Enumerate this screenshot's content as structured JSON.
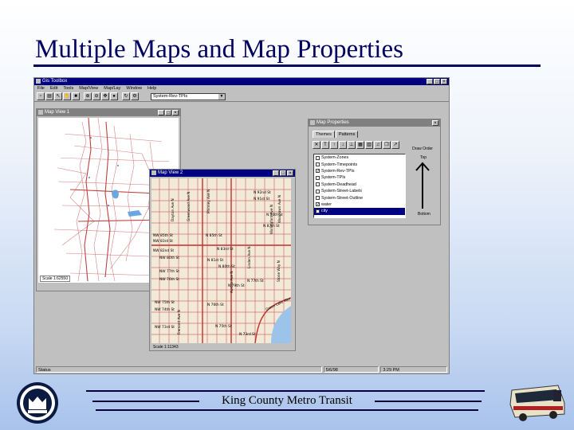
{
  "slide": {
    "title": "Multiple Maps and Map Properties",
    "footer": "King County Metro Transit"
  },
  "app": {
    "title": "Gis Toolbox",
    "menu": [
      "File",
      "Edit",
      "Tools",
      "Map/View",
      "Map/Lay",
      "Window",
      "Help"
    ],
    "toolbar_icons": [
      "new-icon",
      "open-icon",
      "arrow-icon",
      "hand-icon",
      "save-icon",
      "zoom-in-icon",
      "zoom-out-icon",
      "pan-icon",
      "globe-icon",
      "refresh-icon",
      "gear-icon"
    ],
    "layer_combo": "System-Rev-TPIs",
    "status": {
      "left": "Status",
      "date": "5/6/98",
      "time": "3:29 PM"
    }
  },
  "map_view_1": {
    "title": "Map View 1",
    "scale": "Scale 1:62550"
  },
  "map_view_2": {
    "title": "Map View 2",
    "scale": "Scale 1:11343",
    "labels": [
      "NW 85th St",
      "NW 83rd St",
      "NW 82nd St",
      "NW 80th St",
      "NW 77th St",
      "NW 76th St",
      "NW 75th St",
      "NW 74th St",
      "NW 73rd St",
      "N 85th St",
      "N 83rd St",
      "N 81st St",
      "N 80th St",
      "N 79th St",
      "N 77th St",
      "N 76th St",
      "N 75th St",
      "N 73rd St",
      "Phinney Ave N",
      "Fremont Ave N",
      "Dayton Ave N",
      "Greenwood Ave N",
      "Aurora Ave N",
      "Linden Ave N",
      "Stone Way N",
      "Wallingford Ave N",
      "Green Lake Way N",
      "Woodlawn Ave N",
      "N 92nd St",
      "N 91st St",
      "N 90th St",
      "N 87th St"
    ]
  },
  "map_properties": {
    "title": "Map Properties",
    "tabs": [
      "Themes",
      "Patterns"
    ],
    "tool_icons": [
      "close-x-icon",
      "text-t-icon",
      "up-icon",
      "down-icon",
      "bottom-icon",
      "grid-icon",
      "table-icon",
      "music-icon",
      "copy-icon",
      "pointer-icon"
    ],
    "layers": [
      {
        "name": "System-Zones",
        "checked": false
      },
      {
        "name": "System-Timepoints",
        "checked": false
      },
      {
        "name": "System-Rev-TPIs",
        "checked": true
      },
      {
        "name": "System-TPIs",
        "checked": false
      },
      {
        "name": "System-Deadhead",
        "checked": false
      },
      {
        "name": "System-Street-Labels",
        "checked": false
      },
      {
        "name": "System-Street-Outline",
        "checked": false
      },
      {
        "name": "water",
        "checked": true
      },
      {
        "name": "city",
        "checked": false,
        "selected": true
      }
    ],
    "draw_order": "Draw Order",
    "top": "Top",
    "bottom": "Bottom"
  },
  "colors": {
    "title": "#000060",
    "active_titlebar": "#000080",
    "street": "#d06060",
    "map_bg": "#f2ead6"
  }
}
